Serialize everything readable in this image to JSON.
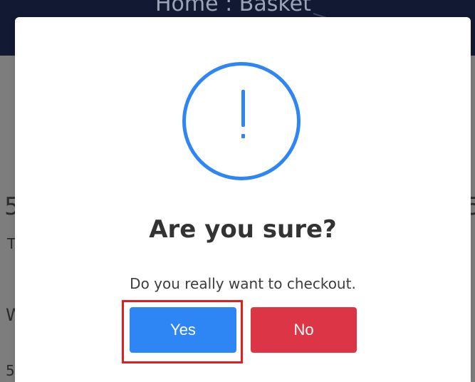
{
  "background": {
    "breadcrumb": "Home  :  Basket",
    "fragments": [
      "5",
      "T",
      "W",
      "5.",
      "5"
    ]
  },
  "modal": {
    "title": "Are you sure?",
    "text": "Do you really want to checkout.",
    "confirm_label": "Yes",
    "cancel_label": "No",
    "icon": "exclamation-circle-icon"
  },
  "colors": {
    "primary": "#2e86f5",
    "danger": "#dc3545",
    "focus_ring": "#e02020",
    "header_bg": "#121a33"
  }
}
